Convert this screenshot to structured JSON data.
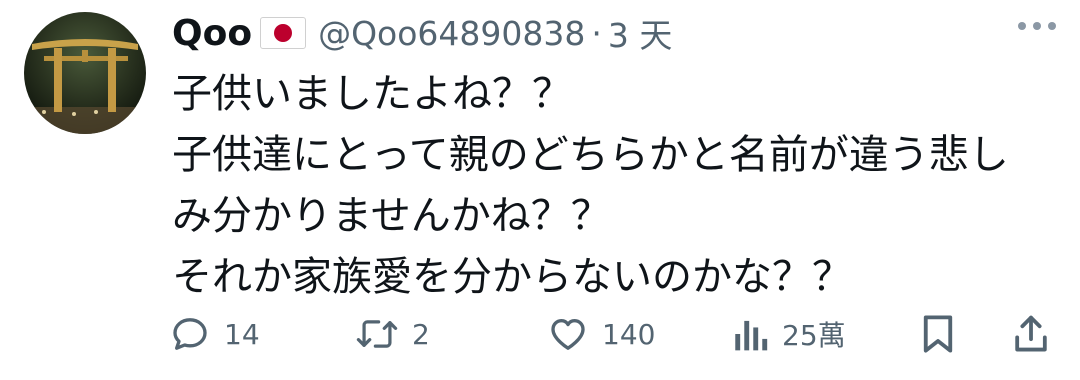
{
  "tweet": {
    "author": {
      "display_name": "Qoo",
      "flag_icon": "japan-flag-icon",
      "handle": "@Qoo64890838",
      "separator": "·",
      "time": "3 天"
    },
    "lines": [
      "子供いましたよね？？",
      "子供達にとって親のどちらかと名前が違う悲し",
      "み分かりませんかね？？",
      "それか家族愛を分からないのかな？？"
    ],
    "actions": {
      "reply_count": "14",
      "retweet_count": "2",
      "like_count": "140",
      "view_count": "25萬"
    }
  }
}
